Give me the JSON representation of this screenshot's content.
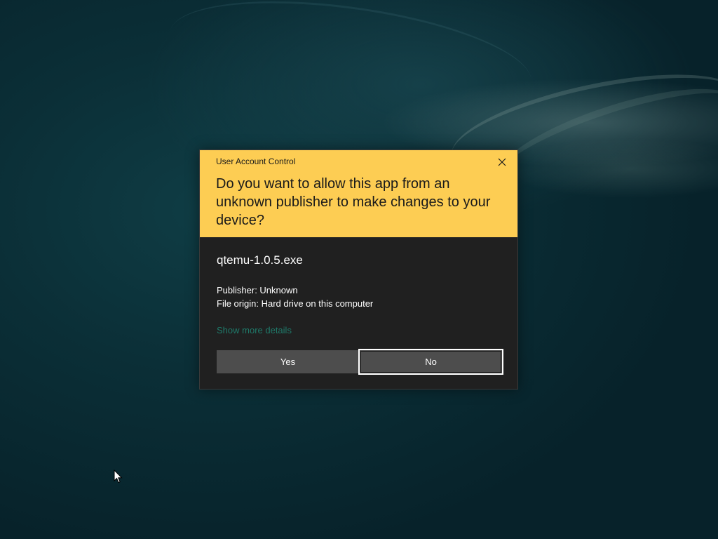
{
  "dialog": {
    "window_title": "User Account Control",
    "question": "Do you want to allow this app from an unknown publisher to make changes to your device?",
    "app_name": "qtemu-1.0.5.exe",
    "publisher_line": "Publisher: Unknown",
    "origin_line": "File origin: Hard drive on this computer",
    "details_link": "Show more details",
    "yes_label": "Yes",
    "no_label": "No",
    "close_icon": "close-icon",
    "focused_button": "No"
  },
  "colors": {
    "header_background": "#fdcd53",
    "dialog_background": "#202020",
    "button_background": "#4d4d4d",
    "link_color": "#1f7a6a"
  },
  "cursor": {
    "icon": "arrow-pointer-icon"
  }
}
